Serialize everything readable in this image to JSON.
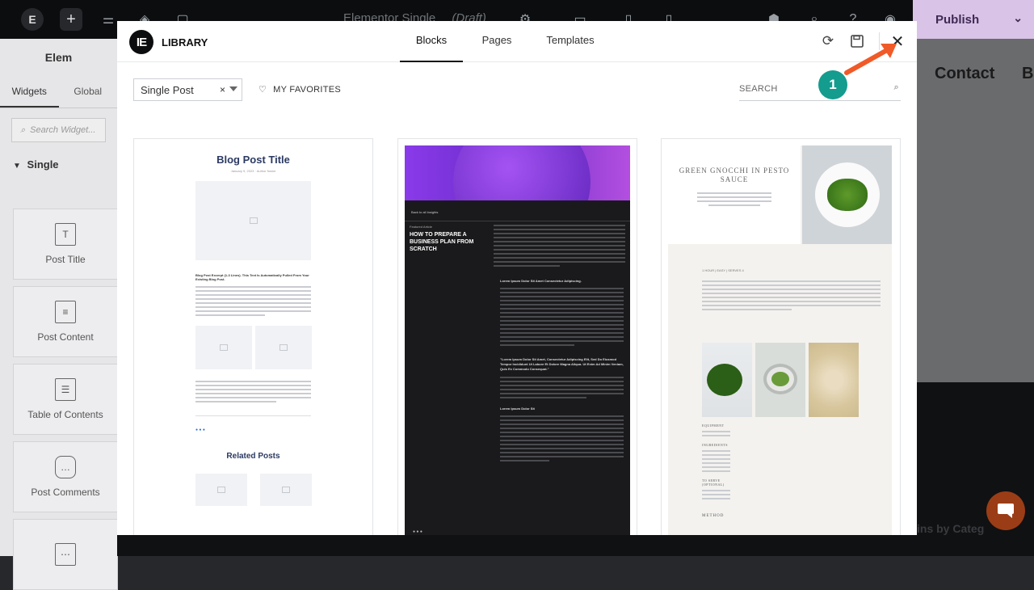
{
  "editor": {
    "doc_title": "Elementor Single",
    "draft_label": "(Draft)",
    "publish_label": "Publish"
  },
  "panel": {
    "title": "Elem",
    "tabs": [
      "Widgets",
      "Global"
    ],
    "search_placeholder": "Search Widget...",
    "section_label": "Single",
    "widgets": [
      {
        "label": "Post Title",
        "icon": "post-title-icon"
      },
      {
        "label": "Post Content",
        "icon": "post-content-icon"
      },
      {
        "label": "Table of Contents",
        "icon": "table-of-contents-icon"
      },
      {
        "label": "Post Comments",
        "icon": "post-comments-icon"
      }
    ]
  },
  "canvas": {
    "nav_contact": "Contact",
    "nav_next": "B",
    "footer_category": "ins by Categ"
  },
  "library": {
    "title": "LIBRARY",
    "tabs": [
      "Blocks",
      "Pages",
      "Templates"
    ],
    "active_tab": "Blocks",
    "filter_value": "Single Post",
    "favorites_label": "MY FAVORITES",
    "search_placeholder": "SEARCH",
    "callout_number": "1",
    "accent_color": "#149c8e",
    "arrow_color": "#f05a28"
  },
  "cards": [
    {
      "heading": "Blog Post Title",
      "meta": "January 9, 2023 · Author Name",
      "excerpt_title": "Blog Post Excerpt (1-3 Lines). This Text Is Automatically Pulled From Your Existing Blog Post.",
      "related_heading": "Related Posts"
    },
    {
      "back_link": "Back to all Insights",
      "kicker": "Featured Article",
      "title": "HOW TO PREPARE A BUSINESS PLAN FROM SCRATCH",
      "subhead1": "Lorem Ipsum Dolor Sit Amet Consectetur Adipiscing.",
      "quote": "\"Lorem Ipsum Dolor Sit Amet, Consectetur Adipiscing Elit, Sed Do Eiusmod Tempor Incididunt Ut Labore Et Dolore Magna Aliqua. Ut Enim Ad Minim Veniam, Quis Ex Commodo Consequat.\"",
      "subhead2": "Lorem Ipsum Dolor Sit"
    },
    {
      "title": "GREEN GNOCCHI IN PESTO SAUCE",
      "meta": "1 HOUR | EASY | SERVES 4",
      "equipment_label": "EQUIPMENT",
      "ingredients_label": "INGREDIENTS",
      "serve_label": "TO SERVE (OPTIONAL)",
      "method_label": "METHOD"
    }
  ]
}
